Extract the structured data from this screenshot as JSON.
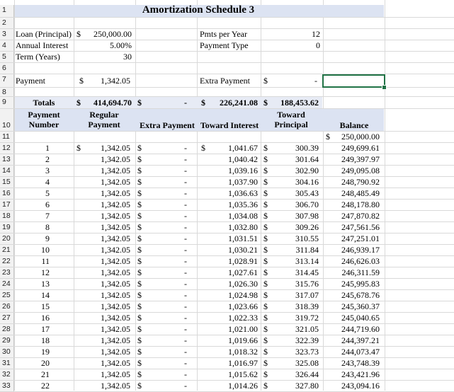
{
  "sheet": {
    "title": "Amortization Schedule 3",
    "inputs": {
      "loan_label": "Loan (Principal)",
      "loan_currency": "$",
      "loan_value": "250,000.00",
      "interest_label": "Annual Interest",
      "interest_value": "5.00%",
      "term_label": "Term (Years)",
      "term_value": "30",
      "pmts_label": "Pmts per Year",
      "pmts_value": "12",
      "ptype_label": "Payment Type",
      "ptype_value": "0",
      "payment_label": "Payment",
      "payment_currency": "$",
      "payment_value": "1,342.05",
      "extra_label": "Extra Payment",
      "extra_currency": "$",
      "extra_value": "-"
    },
    "totals": {
      "label": "Totals",
      "cur1": "$",
      "regular": "414,694.70",
      "cur2": "$",
      "extra": "-",
      "cur3": "$",
      "interest": "226,241.08",
      "cur4": "$",
      "principal": "188,453.62"
    },
    "headers": {
      "payment_number": "Payment Number",
      "regular_payment": "Regular Payment",
      "extra_payment": "Extra Payment",
      "toward_interest": "Toward Interest",
      "toward_principal": "Toward Principal",
      "balance": "Balance"
    },
    "start_balance_currency": "$",
    "start_balance": "250,000.00",
    "schedule": [
      {
        "n": "1",
        "reg": "1,342.05",
        "extra": "-",
        "int": "1,041.67",
        "prin": "300.39",
        "bal": "249,699.61"
      },
      {
        "n": "2",
        "reg": "1,342.05",
        "extra": "-",
        "int": "1,040.42",
        "prin": "301.64",
        "bal": "249,397.97"
      },
      {
        "n": "3",
        "reg": "1,342.05",
        "extra": "-",
        "int": "1,039.16",
        "prin": "302.90",
        "bal": "249,095.08"
      },
      {
        "n": "4",
        "reg": "1,342.05",
        "extra": "-",
        "int": "1,037.90",
        "prin": "304.16",
        "bal": "248,790.92"
      },
      {
        "n": "5",
        "reg": "1,342.05",
        "extra": "-",
        "int": "1,036.63",
        "prin": "305.43",
        "bal": "248,485.49"
      },
      {
        "n": "6",
        "reg": "1,342.05",
        "extra": "-",
        "int": "1,035.36",
        "prin": "306.70",
        "bal": "248,178.80"
      },
      {
        "n": "7",
        "reg": "1,342.05",
        "extra": "-",
        "int": "1,034.08",
        "prin": "307.98",
        "bal": "247,870.82"
      },
      {
        "n": "8",
        "reg": "1,342.05",
        "extra": "-",
        "int": "1,032.80",
        "prin": "309.26",
        "bal": "247,561.56"
      },
      {
        "n": "9",
        "reg": "1,342.05",
        "extra": "-",
        "int": "1,031.51",
        "prin": "310.55",
        "bal": "247,251.01"
      },
      {
        "n": "10",
        "reg": "1,342.05",
        "extra": "-",
        "int": "1,030.21",
        "prin": "311.84",
        "bal": "246,939.17"
      },
      {
        "n": "11",
        "reg": "1,342.05",
        "extra": "-",
        "int": "1,028.91",
        "prin": "313.14",
        "bal": "246,626.03"
      },
      {
        "n": "12",
        "reg": "1,342.05",
        "extra": "-",
        "int": "1,027.61",
        "prin": "314.45",
        "bal": "246,311.59"
      },
      {
        "n": "13",
        "reg": "1,342.05",
        "extra": "-",
        "int": "1,026.30",
        "prin": "315.76",
        "bal": "245,995.83"
      },
      {
        "n": "14",
        "reg": "1,342.05",
        "extra": "-",
        "int": "1,024.98",
        "prin": "317.07",
        "bal": "245,678.76"
      },
      {
        "n": "15",
        "reg": "1,342.05",
        "extra": "-",
        "int": "1,023.66",
        "prin": "318.39",
        "bal": "245,360.37"
      },
      {
        "n": "16",
        "reg": "1,342.05",
        "extra": "-",
        "int": "1,022.33",
        "prin": "319.72",
        "bal": "245,040.65"
      },
      {
        "n": "17",
        "reg": "1,342.05",
        "extra": "-",
        "int": "1,021.00",
        "prin": "321.05",
        "bal": "244,719.60"
      },
      {
        "n": "18",
        "reg": "1,342.05",
        "extra": "-",
        "int": "1,019.66",
        "prin": "322.39",
        "bal": "244,397.21"
      },
      {
        "n": "19",
        "reg": "1,342.05",
        "extra": "-",
        "int": "1,018.32",
        "prin": "323.73",
        "bal": "244,073.47"
      },
      {
        "n": "20",
        "reg": "1,342.05",
        "extra": "-",
        "int": "1,016.97",
        "prin": "325.08",
        "bal": "243,748.39"
      },
      {
        "n": "21",
        "reg": "1,342.05",
        "extra": "-",
        "int": "1,015.62",
        "prin": "326.44",
        "bal": "243,421.96"
      },
      {
        "n": "22",
        "reg": "1,342.05",
        "extra": "-",
        "int": "1,014.26",
        "prin": "327.80",
        "bal": "243,094.16"
      }
    ],
    "row_numbers": [
      "1",
      "2",
      "3",
      "4",
      "5",
      "6",
      "7",
      "8",
      "9",
      "10",
      "11",
      "12",
      "13",
      "14",
      "15",
      "16",
      "17",
      "18",
      "19",
      "20",
      "21",
      "22",
      "23",
      "24",
      "25",
      "26",
      "27",
      "28",
      "29",
      "30",
      "31",
      "32",
      "33"
    ],
    "colors": {
      "header_band": "#dce3f2",
      "selection": "#217346",
      "gridline": "#d9d9d9"
    }
  }
}
